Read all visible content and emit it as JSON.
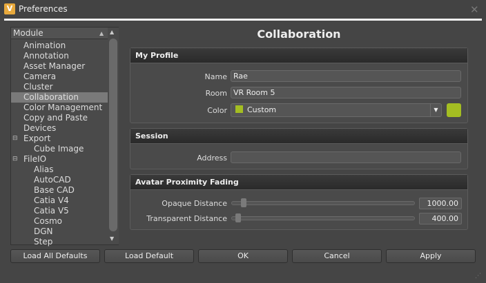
{
  "window": {
    "title": "Preferences",
    "app_icon": "V",
    "close_label": "✕"
  },
  "tree": {
    "header": "Module",
    "items": [
      {
        "label": "Animation",
        "level": 0
      },
      {
        "label": "Annotation",
        "level": 0
      },
      {
        "label": "Asset Manager",
        "level": 0
      },
      {
        "label": "Camera",
        "level": 0
      },
      {
        "label": "Cluster",
        "level": 0
      },
      {
        "label": "Collaboration",
        "level": 0,
        "selected": true
      },
      {
        "label": "Color Management",
        "level": 0
      },
      {
        "label": "Copy and Paste",
        "level": 0
      },
      {
        "label": "Devices",
        "level": 0
      },
      {
        "label": "Export",
        "level": 0,
        "expanded": true
      },
      {
        "label": "Cube Image",
        "level": 1
      },
      {
        "label": "FileIO",
        "level": 0,
        "expanded": true
      },
      {
        "label": "Alias",
        "level": 1
      },
      {
        "label": "AutoCAD",
        "level": 1
      },
      {
        "label": "Base CAD",
        "level": 1
      },
      {
        "label": "Catia V4",
        "level": 1
      },
      {
        "label": "Catia V5",
        "level": 1
      },
      {
        "label": "Cosmo",
        "level": 1
      },
      {
        "label": "DGN",
        "level": 1
      },
      {
        "label": "Step",
        "level": 1
      }
    ]
  },
  "page": {
    "title": "Collaboration"
  },
  "profile": {
    "title": "My Profile",
    "name_label": "Name",
    "name_value": "Rae",
    "room_label": "Room",
    "room_value": "VR Room 5",
    "color_label": "Color",
    "color_value": "Custom",
    "color_hex": "#a4be22"
  },
  "session": {
    "title": "Session",
    "address_label": "Address",
    "address_value": ""
  },
  "fading": {
    "title": "Avatar Proximity Fading",
    "opaque_label": "Opaque Distance",
    "opaque_value": "1000.00",
    "opaque_fraction": 0.05,
    "transparent_label": "Transparent Distance",
    "transparent_value": "400.00",
    "transparent_fraction": 0.02
  },
  "buttons": {
    "load_all": "Load All Defaults",
    "load_default": "Load Default",
    "ok": "OK",
    "cancel": "Cancel",
    "apply": "Apply"
  }
}
